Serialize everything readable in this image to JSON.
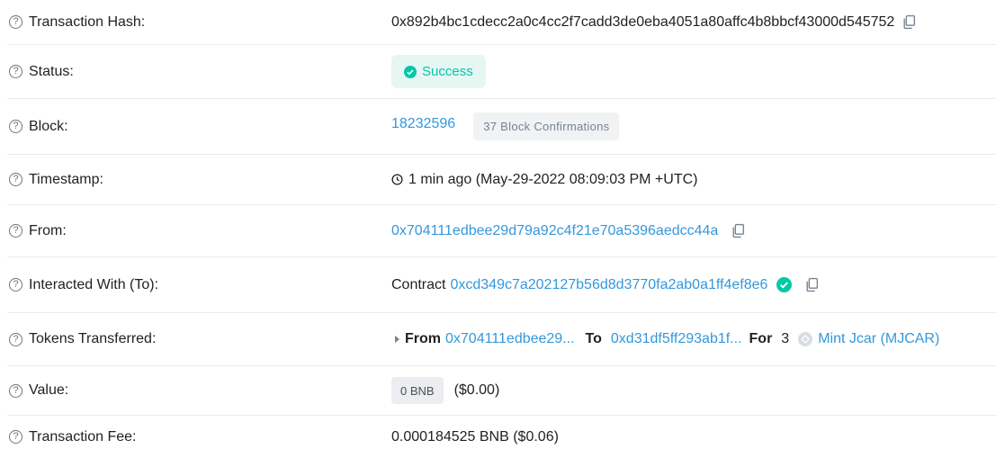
{
  "rows": {
    "tx_hash": {
      "label": "Transaction Hash:",
      "value": "0x892b4bc1cdecc2a0c4cc2f7cadd3de0eba4051a80affc4b8bbcf43000d545752"
    },
    "status": {
      "label": "Status:",
      "value": "Success"
    },
    "block": {
      "label": "Block:",
      "number": "18232596",
      "confirmations": "37 Block Confirmations"
    },
    "timestamp": {
      "label": "Timestamp:",
      "value": "1 min ago (May-29-2022 08:09:03 PM +UTC)"
    },
    "from": {
      "label": "From:",
      "address": "0x704111edbee29d79a92c4f21e70a5396aedcc44a"
    },
    "interacted": {
      "label": "Interacted With (To):",
      "prefix": "Contract",
      "address": "0xcd349c7a202127b56d8d3770fa2ab0a1ff4ef8e6"
    },
    "tokens": {
      "label": "Tokens Transferred:",
      "from_label": "From",
      "from_address": "0x704111edbee29...",
      "to_label": "To",
      "to_address": "0xd31df5ff293ab1f...",
      "for_label": "For",
      "amount": "3",
      "token_name": "Mint Jcar (MJCAR)"
    },
    "value": {
      "label": "Value:",
      "amount": "0 BNB",
      "usd": "($0.00)"
    },
    "fee": {
      "label": "Transaction Fee:",
      "value": "0.000184525 BNB ($0.06)"
    }
  },
  "colors": {
    "link": "#3498db",
    "success": "#00c9a7",
    "success_bg": "#e6f6f3"
  }
}
